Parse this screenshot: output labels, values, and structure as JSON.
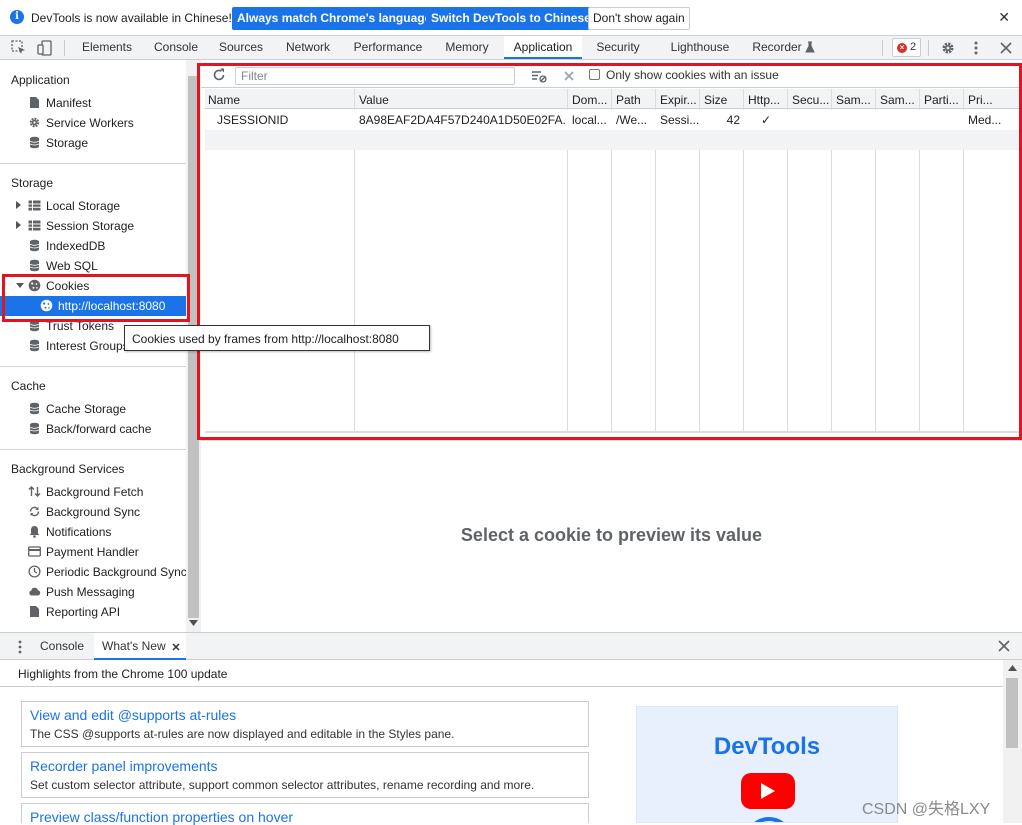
{
  "infobar": {
    "message": "DevTools is now available in Chinese!",
    "btn_match": "Always match Chrome's language",
    "btn_switch": "Switch DevTools to Chinese",
    "btn_dont_show": "Don't show again",
    "close": "✕"
  },
  "toolbar": {
    "tabs": [
      "Elements",
      "Console",
      "Sources",
      "Network",
      "Performance",
      "Memory",
      "Application",
      "Security",
      "Lighthouse",
      "Recorder"
    ],
    "active_tab": "Application",
    "error_count": "2"
  },
  "sidebar": {
    "application_title": "Application",
    "application_items": [
      "Manifest",
      "Service Workers",
      "Storage"
    ],
    "storage_title": "Storage",
    "storage_items": [
      "Local Storage",
      "Session Storage",
      "IndexedDB",
      "Web SQL",
      "Cookies",
      "http://localhost:8080",
      "Trust Tokens",
      "Interest Groups"
    ],
    "cache_title": "Cache",
    "cache_items": [
      "Cache Storage",
      "Back/forward cache"
    ],
    "bg_title": "Background Services",
    "bg_items": [
      "Background Fetch",
      "Background Sync",
      "Notifications",
      "Payment Handler",
      "Periodic Background Sync",
      "Push Messaging",
      "Reporting API"
    ]
  },
  "tooltip": "Cookies used by frames from http://localhost:8080",
  "cookies": {
    "filter_placeholder": "Filter",
    "only_issue_label": "Only show cookies with an issue",
    "columns": [
      "Name",
      "Value",
      "Dom...",
      "Path",
      "Expir...",
      "Size",
      "Http...",
      "Secu...",
      "Sam...",
      "Sam...",
      "Parti...",
      "Pri..."
    ],
    "rows": [
      [
        "JSESSIONID",
        "8A98EAF2DA4F57D240A1D50E02FA...",
        "local...",
        "/We...",
        "Sessi...",
        "42",
        "✓",
        "",
        "",
        "",
        "",
        "Med..."
      ]
    ],
    "preview_message": "Select a cookie to preview its value"
  },
  "drawer": {
    "tabs": [
      "Console",
      "What's New"
    ],
    "active_tab": "What's New",
    "highlights": "Highlights from the Chrome 100 update",
    "cards": [
      {
        "title": "View and edit @supports at-rules",
        "desc": "The CSS @supports at-rules are now displayed and editable in the Styles pane."
      },
      {
        "title": "Recorder panel improvements",
        "desc": "Set custom selector attribute, support common selector attributes, rename recording and more."
      },
      {
        "title": "Preview class/function properties on hover",
        "desc": ""
      }
    ],
    "promo_title": "DevTools"
  },
  "watermark": "CSDN @失格LXY",
  "colors": {
    "accent": "#1a73e8",
    "highlight_box": "#e1141f",
    "error": "#d93025",
    "youtube": "#ff0000"
  }
}
